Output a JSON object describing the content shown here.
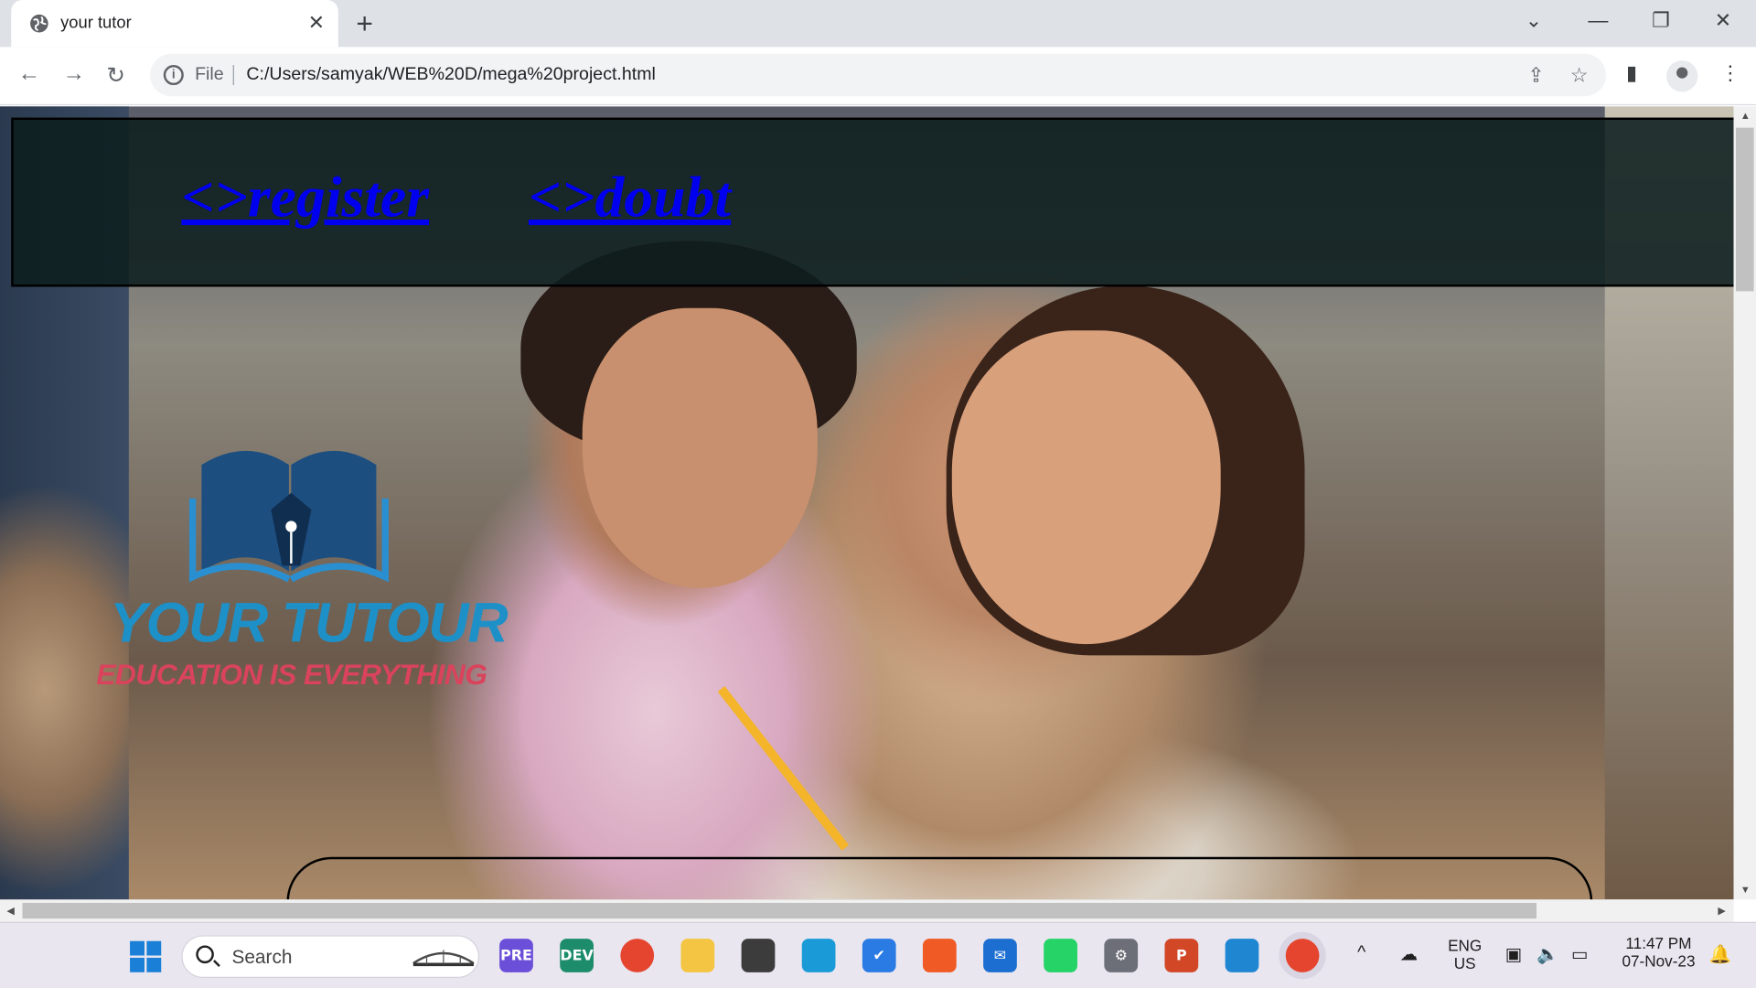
{
  "browser": {
    "tab_title": "your tutor",
    "tab_close": "✕",
    "new_tab": "+",
    "address_scheme": "File",
    "url": "C:/Users/samyak/WEB%20D/mega%20project.html",
    "window_controls": {
      "dropdown": "⌄",
      "minimize": "—",
      "restore": "❐",
      "close": "✕"
    }
  },
  "page": {
    "nav_links": [
      {
        "label": "<>register "
      },
      {
        "label": "<>doubt"
      }
    ],
    "logo": {
      "title": "YOUR TUTOUR",
      "tagline": "EDUCATION IS EVERYTHING"
    }
  },
  "taskbar": {
    "search_placeholder": "Search",
    "language": {
      "line1": "ENG",
      "line2": "US"
    },
    "clock": {
      "time": "11:47 PM",
      "date": "07-Nov-23"
    },
    "apps": [
      {
        "name": "copilot-preview",
        "badge": "PRE",
        "color": "#6b4fd8"
      },
      {
        "name": "edge-dev",
        "badge": "DEV",
        "color": "#1c8c6a"
      },
      {
        "name": "chrome",
        "badge": "",
        "color": "#e5452f"
      },
      {
        "name": "file-explorer",
        "badge": "",
        "color": "#f4c542"
      },
      {
        "name": "whatsapp",
        "badge": "",
        "color": "#3c3c3c"
      },
      {
        "name": "edge",
        "badge": "",
        "color": "#1a9bd7"
      },
      {
        "name": "todo",
        "badge": "✔",
        "color": "#2a7be4"
      },
      {
        "name": "brave",
        "badge": "",
        "color": "#f05a24"
      },
      {
        "name": "mail",
        "badge": "✉",
        "color": "#1c6fd1"
      },
      {
        "name": "whatsapp-green",
        "badge": "",
        "color": "#25d366"
      },
      {
        "name": "settings",
        "badge": "⚙",
        "color": "#6d6f78"
      },
      {
        "name": "powerpoint",
        "badge": "P",
        "color": "#d24726"
      },
      {
        "name": "vscode",
        "badge": "",
        "color": "#1f86d2"
      },
      {
        "name": "chrome-active",
        "badge": "",
        "color": "#e5452f"
      }
    ]
  }
}
